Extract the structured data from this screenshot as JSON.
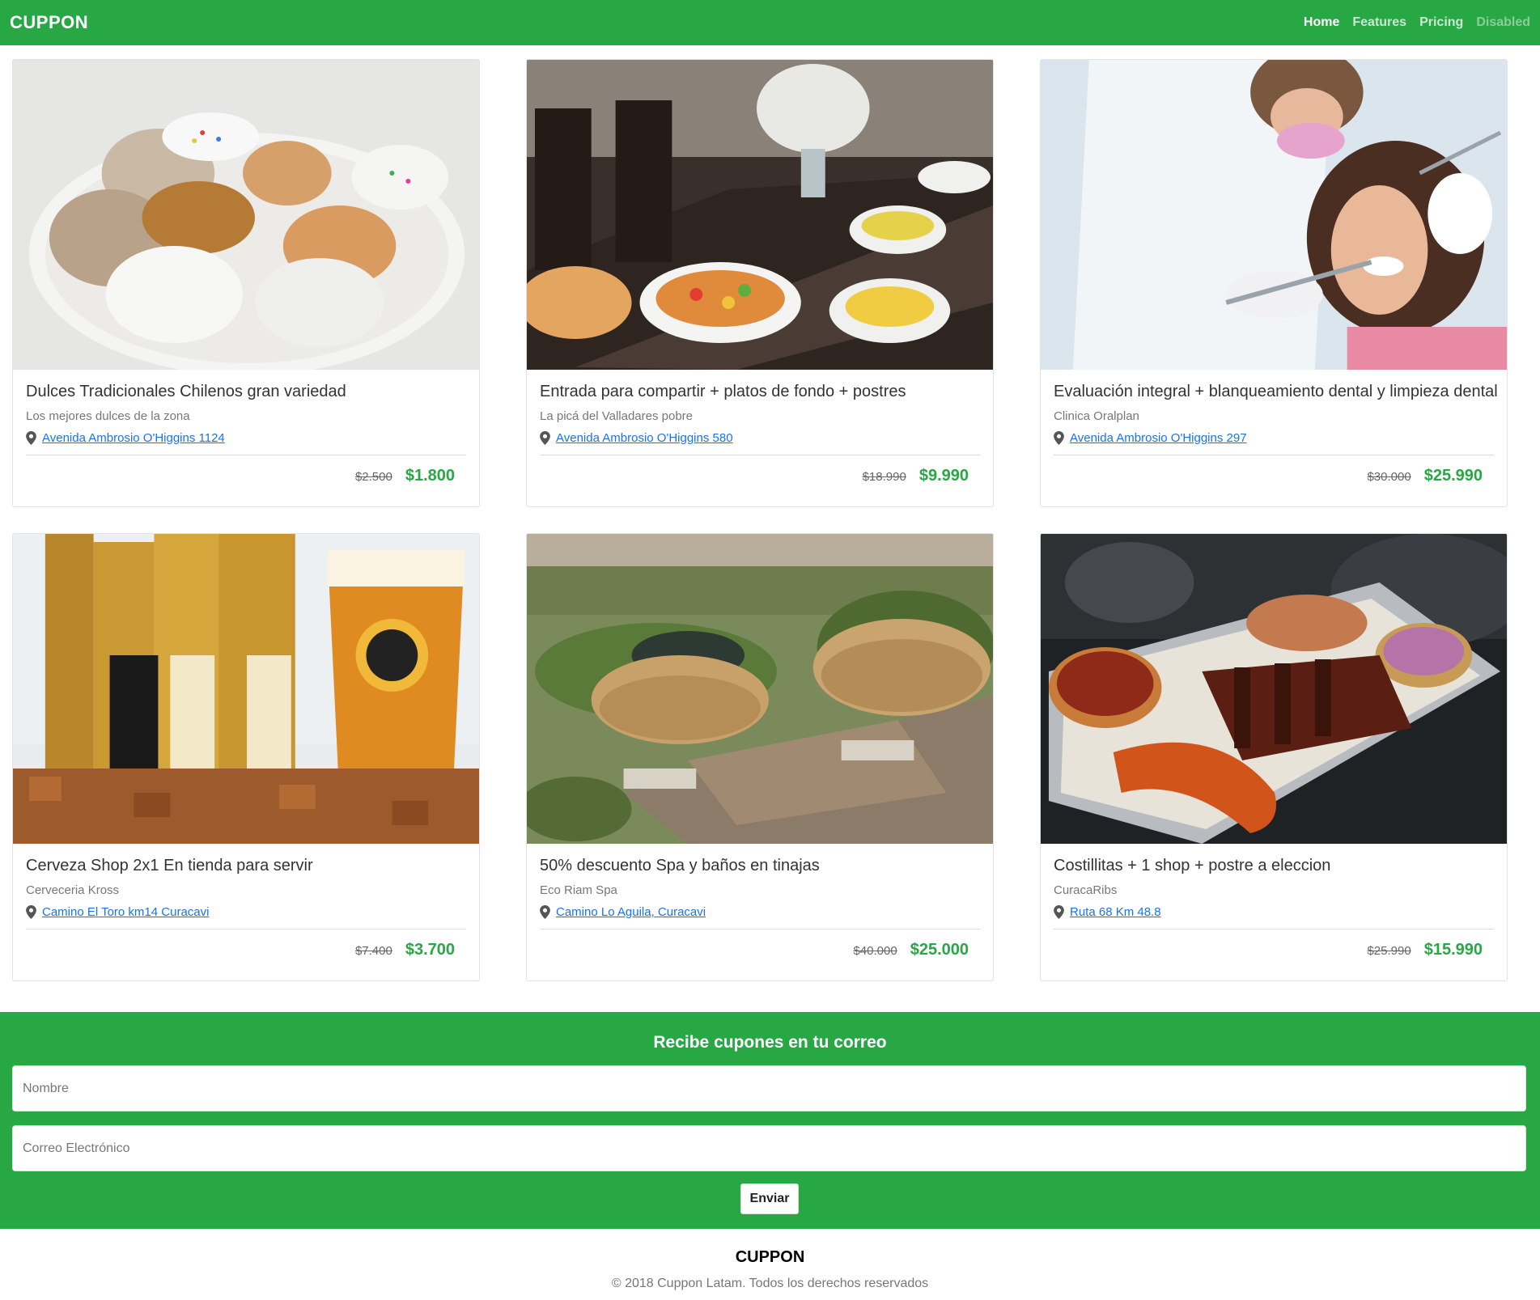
{
  "navbar": {
    "brand": "CUPPON",
    "links": [
      {
        "label": "Home",
        "state": "active"
      },
      {
        "label": "Features",
        "state": "normal"
      },
      {
        "label": "Pricing",
        "state": "normal"
      },
      {
        "label": "Disabled",
        "state": "disabled"
      }
    ]
  },
  "cards": [
    {
      "image": "traditional-chilean-pastries-photo",
      "title": "Dulces Tradicionales Chilenos gran variedad",
      "subtitle": "Los mejores dulces de la zona",
      "address": "Avenida Ambrosio O'Higgins 1124",
      "old_price": "$2.500",
      "new_price": "$1.800"
    },
    {
      "image": "restaurant-table-dishes-photo",
      "title": "Entrada para compartir + platos de fondo + postres",
      "subtitle": "La picá del Valladares pobre",
      "address": "Avenida Ambrosio O'Higgins 580",
      "old_price": "$18.990",
      "new_price": "$9.990"
    },
    {
      "image": "dentist-patient-photo",
      "title": "Evaluación integral + blanqueamiento dental y limpieza dental",
      "subtitle": "Clinica Oralplan",
      "address": "Avenida Ambrosio O'Higgins 297",
      "old_price": "$30.000",
      "new_price": "$25.990"
    },
    {
      "image": "kross-golden-beer-cans-photo",
      "title": "Cerveza Shop 2x1 En tienda para servir",
      "subtitle": "Cerveceria Kross",
      "address": "Camino El Toro km14 Curacavi",
      "old_price": "$7.400",
      "new_price": "$3.700"
    },
    {
      "image": "spa-pond-thatched-umbrellas-photo",
      "title": "50% descuento Spa y baños en tinajas",
      "subtitle": "Eco Riam Spa",
      "address": "Camino Lo Aguila, Curacavi",
      "old_price": "$40.000",
      "new_price": "$25.000"
    },
    {
      "image": "bbq-ribs-sausages-tray-photo",
      "title": "Costillitas + 1 shop + postre a eleccion",
      "subtitle": "CuracaRibs",
      "address": "Ruta 68 Km 48.8",
      "old_price": "$25.990",
      "new_price": "$15.990"
    }
  ],
  "subscribe": {
    "title": "Recibe cupones en tu correo",
    "name_placeholder": "Nombre",
    "email_placeholder": "Correo Electrónico",
    "button_label": "Enviar"
  },
  "footer": {
    "brand": "CUPPON",
    "copyright": "© 2018 Cuppon Latam. Todos los derechos reservados"
  },
  "colors": {
    "brand_green": "#28a745",
    "link_blue": "#1a73e8"
  }
}
